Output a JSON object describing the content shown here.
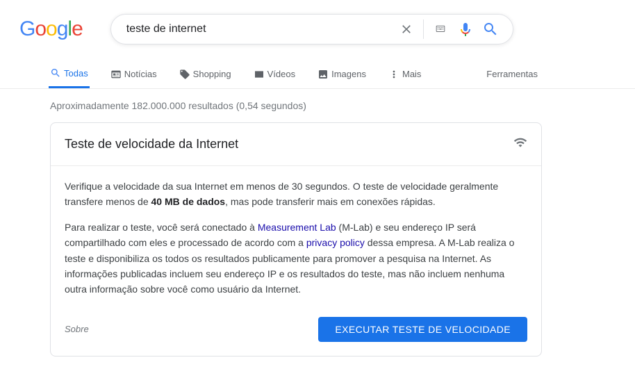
{
  "logo": {
    "g": "G",
    "o1": "o",
    "o2": "o",
    "g2": "g",
    "l": "l",
    "e": "e"
  },
  "search": {
    "query": "teste de internet",
    "clear_icon": "close",
    "keyboard_icon": "keyboard",
    "mic_icon": "microphone",
    "search_icon": "search"
  },
  "tabs": {
    "todas": "Todas",
    "noticias": "Notícias",
    "shopping": "Shopping",
    "videos": "Vídeos",
    "imagens": "Imagens",
    "mais": "Mais",
    "ferramentas": "Ferramentas"
  },
  "stats": "Aproximadamente 182.000.000 resultados (0,54 segundos)",
  "card": {
    "title": "Teste de velocidade da Internet",
    "p1_a": "Verifique a velocidade da sua Internet em menos de 30 segundos. O teste de velocidade geralmente transfere menos de ",
    "p1_bold": "40 MB de dados",
    "p1_b": ", mas pode transferir mais em conexões rápidas.",
    "p2_a": "Para realizar o teste, você será conectado à ",
    "p2_link1": "Measurement Lab",
    "p2_b": " (M-Lab) e seu endereço IP será compartilhado com eles e processado de acordo com a ",
    "p2_link2": "privacy policy",
    "p2_c": " dessa empresa. A M-Lab realiza o teste e disponibiliza os todos os resultados publicamente para promover a pesquisa na Internet. As informações publicadas incluem seu endereço IP e os resultados do teste, mas não incluem nenhuma outra informação sobre você como usuário da Internet.",
    "sobre": "Sobre",
    "run_button": "EXECUTAR TESTE DE VELOCIDADE"
  }
}
